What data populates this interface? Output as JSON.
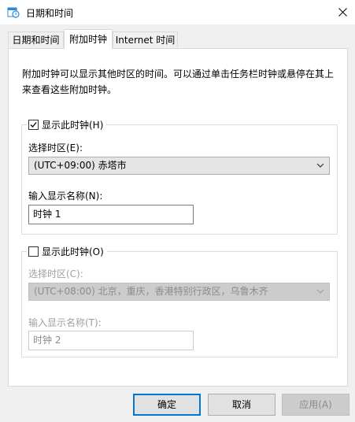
{
  "window": {
    "title": "日期和时间"
  },
  "tabs": [
    {
      "label": "日期和时间",
      "active": false
    },
    {
      "label": "附加时钟",
      "active": true
    },
    {
      "label": "Internet 时间",
      "active": false
    }
  ],
  "description": "附加时钟可以显示其他时区的时间。可以通过单击任务栏时钟或悬停在其上来查看这些附加时钟。",
  "clock1": {
    "checkbox_label": "显示此时钟(H)",
    "checked": true,
    "timezone_label": "选择时区(E):",
    "timezone_value": "(UTC+09:00) 赤塔市",
    "name_label": "输入显示名称(N):",
    "name_value": "时钟 1"
  },
  "clock2": {
    "checkbox_label": "显示此时钟(O)",
    "checked": false,
    "timezone_label": "选择时区(C):",
    "timezone_value": "(UTC+08:00) 北京，重庆，香港特别行政区，乌鲁木齐",
    "name_label": "输入显示名称(T):",
    "name_value": "时钟 2"
  },
  "buttons": {
    "ok": "确定",
    "cancel": "取消",
    "apply": "应用(A)"
  },
  "colors": {
    "accent": "#0078d7",
    "icon_blue": "#2b88d8"
  },
  "icons": [
    "clock-calendar-icon",
    "close-icon",
    "checkmark-icon",
    "chevron-down-icon"
  ]
}
